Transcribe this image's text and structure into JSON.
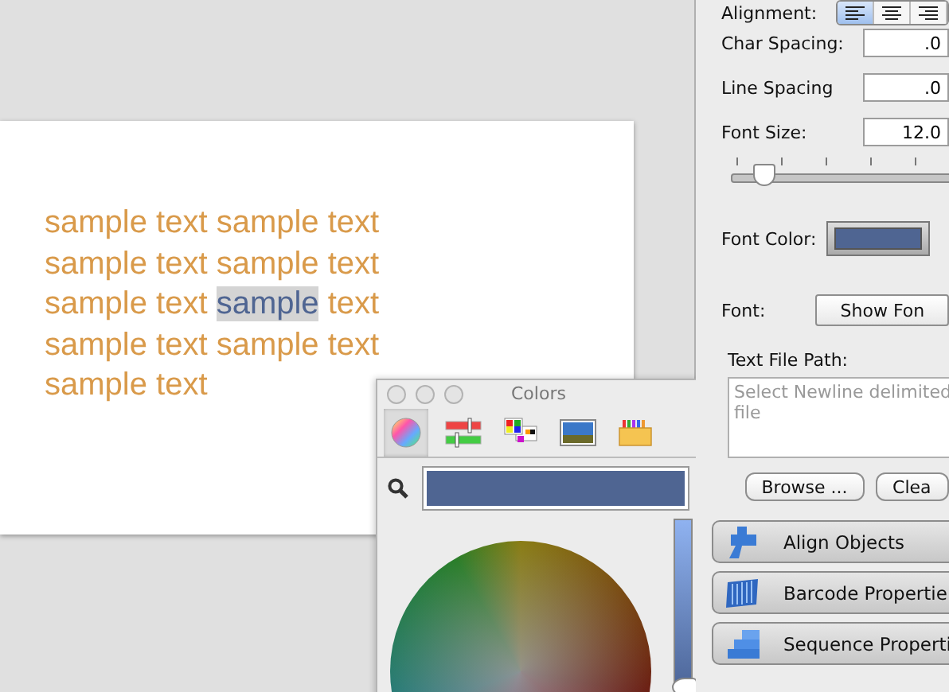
{
  "document": {
    "lines": [
      [
        {
          "text": "sample text sample text",
          "selected": false
        }
      ],
      [
        {
          "text": "sample text sample text",
          "selected": false
        }
      ],
      [
        {
          "text": "sample text ",
          "selected": false
        },
        {
          "text": "sample",
          "selected": true
        },
        {
          "text": " text",
          "selected": false
        }
      ],
      [
        {
          "text": "sample text sample text",
          "selected": false
        }
      ],
      [
        {
          "text": "sample text",
          "selected": false
        }
      ]
    ]
  },
  "properties": {
    "alignment": {
      "label": "Alignment:",
      "options": [
        {
          "kind": "left",
          "selected": true
        },
        {
          "kind": "center",
          "selected": false
        },
        {
          "kind": "right",
          "selected": false
        }
      ]
    },
    "char_spacing": {
      "label": "Char Spacing:",
      "value": ".0"
    },
    "line_spacing": {
      "label": "Line Spacing",
      "value": ".0"
    },
    "font_size": {
      "label": "Font Size:",
      "value": "12.0",
      "level": 0.1
    },
    "font_color": {
      "label": "Font Color:",
      "color": "#4f6592"
    },
    "font": {
      "label": "Font:",
      "button": "Show Fon"
    },
    "text_file_path": {
      "label": "Text File Path:",
      "placeholder": "Select Newline delimited\nfile"
    },
    "buttons": [
      "Browse ...",
      "Clea"
    ],
    "sections": [
      {
        "kind": "align",
        "label": "Align Objects"
      },
      {
        "kind": "barcode",
        "label": "Barcode Propertie"
      },
      {
        "kind": "sequence",
        "label": "Sequence Properti"
      }
    ]
  },
  "colors_window": {
    "title": "Colors",
    "tabs": [
      {
        "kind": "wheel",
        "selected": true
      },
      {
        "kind": "sliders",
        "selected": false
      },
      {
        "kind": "palettes",
        "selected": false
      },
      {
        "kind": "image",
        "selected": false
      },
      {
        "kind": "crayons",
        "selected": false
      }
    ],
    "brightness": {
      "level": 0.15
    }
  }
}
